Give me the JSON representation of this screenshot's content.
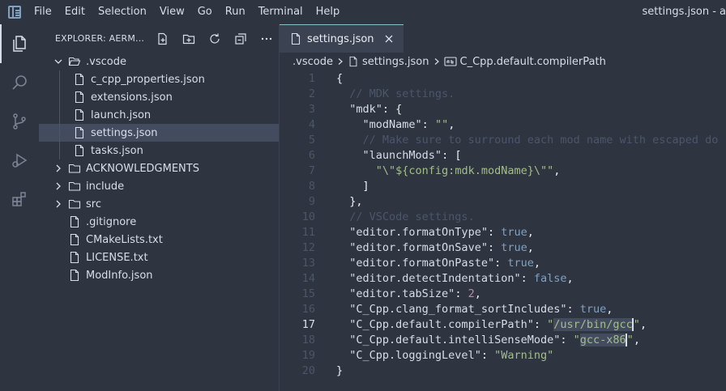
{
  "menu": [
    "File",
    "Edit",
    "Selection",
    "View",
    "Go",
    "Run",
    "Terminal",
    "Help"
  ],
  "window_title": "settings.json - a",
  "explorer": {
    "title": "EXPLORER: AERM...",
    "tree": [
      {
        "label": ".vscode",
        "type": "folder-open",
        "depth": 0
      },
      {
        "label": "c_cpp_properties.json",
        "type": "file",
        "depth": 1
      },
      {
        "label": "extensions.json",
        "type": "file",
        "depth": 1
      },
      {
        "label": "launch.json",
        "type": "file",
        "depth": 1
      },
      {
        "label": "settings.json",
        "type": "file",
        "depth": 1,
        "selected": true
      },
      {
        "label": "tasks.json",
        "type": "file",
        "depth": 1
      },
      {
        "label": "ACKNOWLEDGMENTS",
        "type": "folder",
        "depth": 0
      },
      {
        "label": "include",
        "type": "folder",
        "depth": 0
      },
      {
        "label": "src",
        "type": "folder",
        "depth": 0
      },
      {
        "label": ".gitignore",
        "type": "file",
        "depth": 0
      },
      {
        "label": "CMakeLists.txt",
        "type": "file",
        "depth": 0
      },
      {
        "label": "LICENSE.txt",
        "type": "file",
        "depth": 0
      },
      {
        "label": "ModInfo.json",
        "type": "file",
        "depth": 0
      }
    ]
  },
  "tab": {
    "label": "settings.json"
  },
  "breadcrumbs": {
    "folder": ".vscode",
    "file": "settings.json",
    "symbol": "C_Cpp.default.compilerPath"
  },
  "editor": {
    "current_line": 17,
    "lines": [
      {
        "n": "1",
        "tokens": [
          [
            "punc",
            "{"
          ]
        ]
      },
      {
        "n": "2",
        "tokens": [
          [
            "sp",
            "  "
          ],
          [
            "cmt",
            "// MDK settings."
          ]
        ]
      },
      {
        "n": "3",
        "tokens": [
          [
            "sp",
            "  "
          ],
          [
            "key",
            "\"mdk\""
          ],
          [
            "punc",
            ": {"
          ]
        ]
      },
      {
        "n": "4",
        "tokens": [
          [
            "sp",
            "    "
          ],
          [
            "key",
            "\"modName\""
          ],
          [
            "punc",
            ": "
          ],
          [
            "str",
            "\"\""
          ],
          [
            "punc",
            ","
          ]
        ]
      },
      {
        "n": "5",
        "tokens": [
          [
            "sp",
            "    "
          ],
          [
            "cmt",
            "// Make sure to surround each mod name with escaped do"
          ]
        ]
      },
      {
        "n": "6",
        "tokens": [
          [
            "sp",
            "    "
          ],
          [
            "key",
            "\"launchMods\""
          ],
          [
            "punc",
            ": ["
          ]
        ]
      },
      {
        "n": "7",
        "tokens": [
          [
            "sp",
            "      "
          ],
          [
            "str",
            "\"\\\"${config:mdk.modName}\\\"\""
          ],
          [
            "punc",
            ","
          ]
        ]
      },
      {
        "n": "8",
        "tokens": [
          [
            "sp",
            "    "
          ],
          [
            "punc",
            "]"
          ]
        ]
      },
      {
        "n": "9",
        "tokens": [
          [
            "sp",
            "  "
          ],
          [
            "punc",
            "},"
          ]
        ]
      },
      {
        "n": "10",
        "tokens": [
          [
            "sp",
            "  "
          ],
          [
            "cmt",
            "// VSCode settings."
          ]
        ]
      },
      {
        "n": "11",
        "tokens": [
          [
            "sp",
            "  "
          ],
          [
            "key",
            "\"editor.formatOnType\""
          ],
          [
            "punc",
            ": "
          ],
          [
            "kw",
            "true"
          ],
          [
            "punc",
            ","
          ]
        ]
      },
      {
        "n": "12",
        "tokens": [
          [
            "sp",
            "  "
          ],
          [
            "key",
            "\"editor.formatOnSave\""
          ],
          [
            "punc",
            ": "
          ],
          [
            "kw",
            "true"
          ],
          [
            "punc",
            ","
          ]
        ]
      },
      {
        "n": "13",
        "tokens": [
          [
            "sp",
            "  "
          ],
          [
            "key",
            "\"editor.formatOnPaste\""
          ],
          [
            "punc",
            ": "
          ],
          [
            "kw",
            "true"
          ],
          [
            "punc",
            ","
          ]
        ]
      },
      {
        "n": "14",
        "tokens": [
          [
            "sp",
            "  "
          ],
          [
            "key",
            "\"editor.detectIndentation\""
          ],
          [
            "punc",
            ": "
          ],
          [
            "kw",
            "false"
          ],
          [
            "punc",
            ","
          ]
        ]
      },
      {
        "n": "15",
        "tokens": [
          [
            "sp",
            "  "
          ],
          [
            "key",
            "\"editor.tabSize\""
          ],
          [
            "punc",
            ": "
          ],
          [
            "num",
            "2"
          ],
          [
            "punc",
            ","
          ]
        ]
      },
      {
        "n": "16",
        "tokens": [
          [
            "sp",
            "  "
          ],
          [
            "key",
            "\"C_Cpp.clang_format_sortIncludes\""
          ],
          [
            "punc",
            ": "
          ],
          [
            "kw",
            "true"
          ],
          [
            "punc",
            ","
          ]
        ]
      },
      {
        "n": "17",
        "tokens": [
          [
            "sp",
            "  "
          ],
          [
            "key",
            "\"C_Cpp.default.compilerPath\""
          ],
          [
            "punc",
            ": "
          ],
          [
            "str",
            "\""
          ],
          [
            "strhl",
            "/usr/bin/gcc"
          ],
          [
            "cursor",
            ""
          ],
          [
            "str",
            "\""
          ],
          [
            "punc",
            ","
          ]
        ]
      },
      {
        "n": "18",
        "tokens": [
          [
            "sp",
            "  "
          ],
          [
            "key",
            "\"C_Cpp.default.intelliSenseMode\""
          ],
          [
            "punc",
            ": "
          ],
          [
            "str",
            "\""
          ],
          [
            "strhl",
            "gcc-x86"
          ],
          [
            "cursor",
            ""
          ],
          [
            "str",
            "\""
          ],
          [
            "punc",
            ","
          ]
        ]
      },
      {
        "n": "19",
        "tokens": [
          [
            "sp",
            "  "
          ],
          [
            "key",
            "\"C_Cpp.loggingLevel\""
          ],
          [
            "punc",
            ": "
          ],
          [
            "str",
            "\"Warning\""
          ]
        ]
      },
      {
        "n": "20",
        "tokens": [
          [
            "punc",
            "}"
          ]
        ]
      }
    ]
  },
  "colors": {
    "background": "#2e3440",
    "selection": "#434c5e",
    "string": "#a3be8c",
    "keyword": "#81a1c1",
    "comment": "#4c566a"
  }
}
